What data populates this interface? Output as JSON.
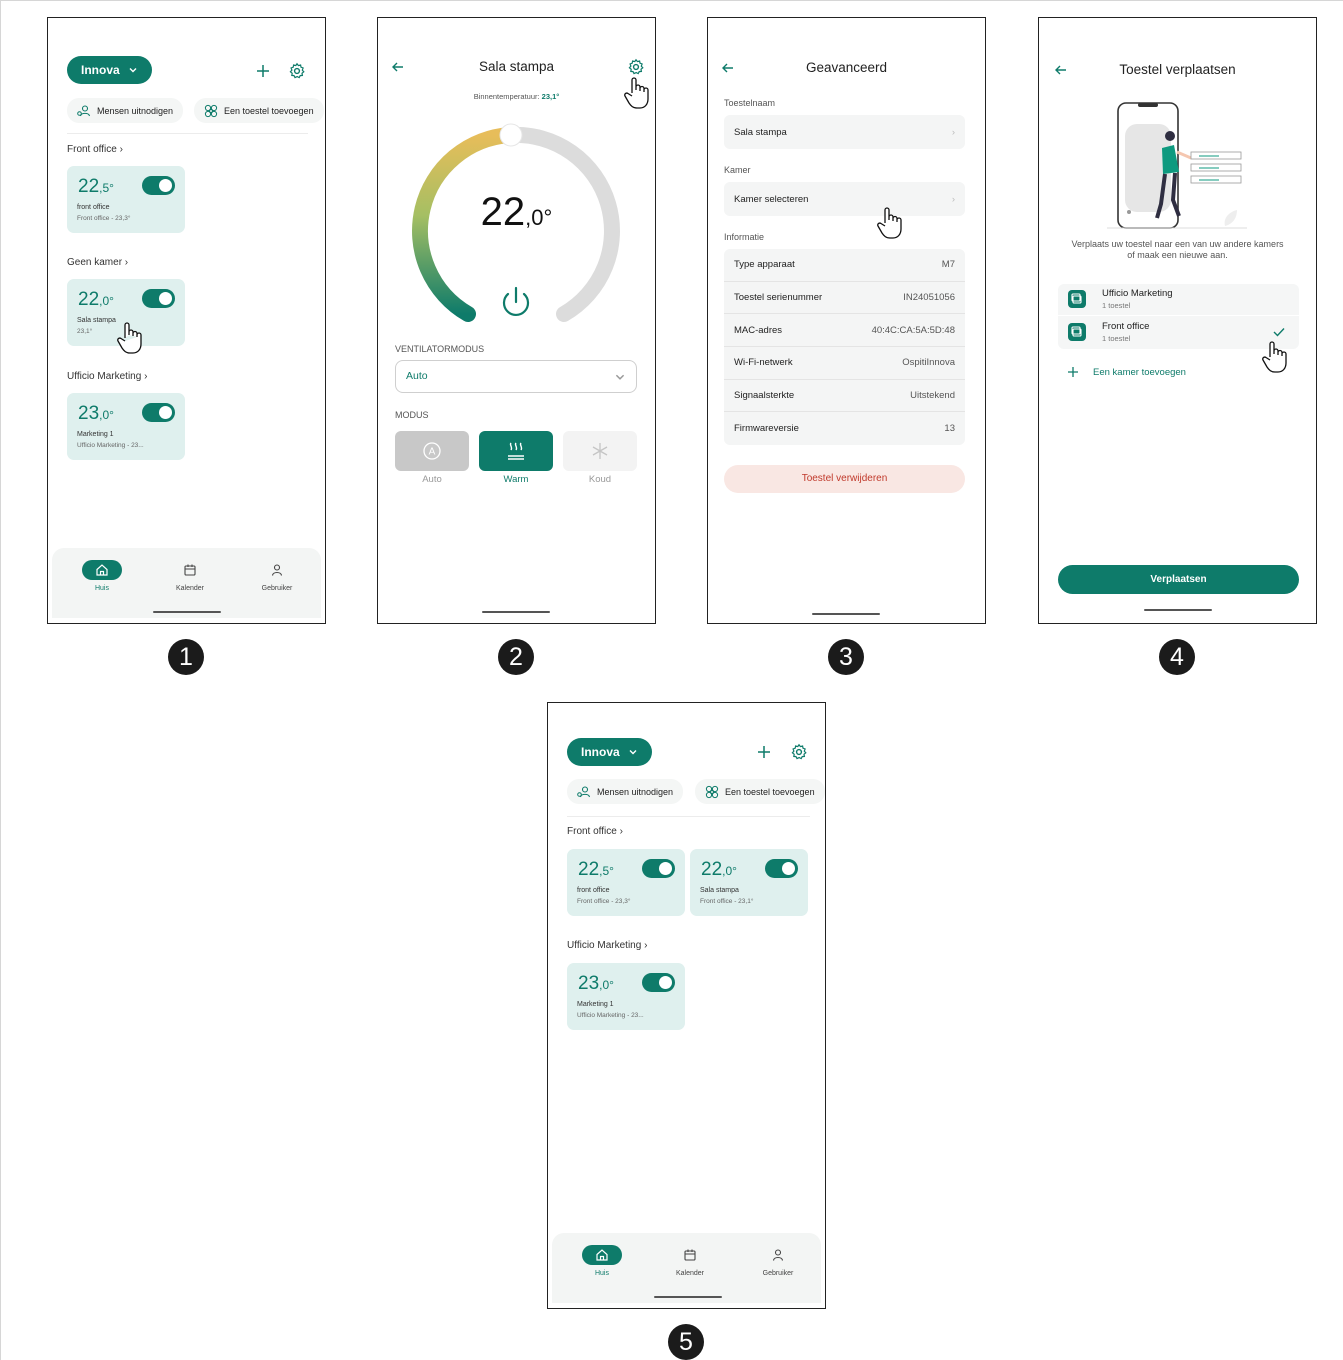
{
  "colors": {
    "accent": "#0e7b6a",
    "card_bg": "#dff0ee",
    "danger": "#c0392b",
    "danger_bg": "#f9e7e3"
  },
  "steps": [
    "1",
    "2",
    "3",
    "4",
    "5"
  ],
  "screen1": {
    "account": "Innova",
    "invite": "Mensen uitnodigen",
    "add_device": "Een toestel toevoegen",
    "rooms": [
      {
        "title": "Front office",
        "device": {
          "temp_int": "22",
          "temp_dec": ",5°",
          "name": "front office",
          "sub": "Front office - 23,3°"
        }
      },
      {
        "title": "Geen kamer",
        "device": {
          "temp_int": "22",
          "temp_dec": ",0°",
          "name": "Sala stampa",
          "sub": "23,1°"
        }
      },
      {
        "title": "Ufficio Marketing",
        "device": {
          "temp_int": "23",
          "temp_dec": ",0°",
          "name": "Marketing 1",
          "sub": "Ufficio Marketing - 23..."
        }
      }
    ],
    "nav": [
      "Huis",
      "Kalender",
      "Gebruiker"
    ]
  },
  "screen2": {
    "title": "Sala stampa",
    "indoor_label": "Binnentemperatuur:",
    "indoor_value": "23,1°",
    "setpoint_int": "22",
    "setpoint_dec": ",0°",
    "fan_label": "VENTILATORMODUS",
    "fan_value": "Auto",
    "mode_label": "MODUS",
    "modes": [
      "Auto",
      "Warm",
      "Koud"
    ],
    "selected_mode": "Warm"
  },
  "screen3": {
    "title": "Geavanceerd",
    "name_label": "Toestelnaam",
    "name_value": "Sala stampa",
    "room_label": "Kamer",
    "room_value": "Kamer selecteren",
    "info_label": "Informatie",
    "info": [
      {
        "k": "Type apparaat",
        "v": "M7"
      },
      {
        "k": "Toestel serienummer",
        "v": "IN24051056"
      },
      {
        "k": "MAC-adres",
        "v": "40:4C:CA:5A:5D:48"
      },
      {
        "k": "Wi-Fi-netwerk",
        "v": "OspitiInnova"
      },
      {
        "k": "Signaalsterkte",
        "v": "Uitstekend"
      },
      {
        "k": "Firmwareversie",
        "v": "13"
      }
    ],
    "remove": "Toestel verwijderen"
  },
  "screen4": {
    "title": "Toestel verplaatsen",
    "description": "Verplaats uw toestel naar een van uw andere kamers of maak een nieuwe aan.",
    "rooms": [
      {
        "name": "Ufficio Marketing",
        "count": "1 toestel",
        "selected": false
      },
      {
        "name": "Front office",
        "count": "1 toestel",
        "selected": true
      }
    ],
    "add_room": "Een kamer toevoegen",
    "move_button": "Verplaatsen"
  },
  "screen5": {
    "account": "Innova",
    "invite": "Mensen uitnodigen",
    "add_device": "Een toestel toevoegen",
    "room1": "Front office",
    "room1_devices": [
      {
        "temp_int": "22",
        "temp_dec": ",5°",
        "name": "front office",
        "sub": "Front office - 23,3°"
      },
      {
        "temp_int": "22",
        "temp_dec": ",0°",
        "name": "Sala stampa",
        "sub": "Front office - 23,1°"
      }
    ],
    "room2": "Ufficio Marketing",
    "room2_device": {
      "temp_int": "23",
      "temp_dec": ",0°",
      "name": "Marketing 1",
      "sub": "Ufficio Marketing - 23..."
    },
    "nav": [
      "Huis",
      "Kalender",
      "Gebruiker"
    ]
  }
}
